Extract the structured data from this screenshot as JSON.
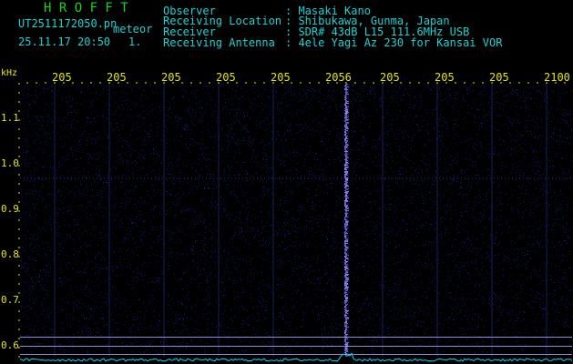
{
  "app": {
    "title": "H R O F F T",
    "filename": "UT2511172050.pn",
    "mode_label": "meteor",
    "datetime": "25.11.17 20:50",
    "index": "1."
  },
  "info": [
    {
      "label": "Observer",
      "value": ": Masaki Kano"
    },
    {
      "label": "Receiving Location",
      "value": ": Shibukawa, Gunma, Japan"
    },
    {
      "label": "Receiver",
      "value": ": SDR# 43dB L15 111.6MHz USB"
    },
    {
      "label": "Receiving Antenna",
      "value": ": 4ele Yagi Az 230 for Kansai VOR"
    }
  ],
  "axis": {
    "y_unit": "kHz",
    "x_ticks": [
      "205",
      "205",
      "205",
      "205",
      "205",
      "2056",
      "205",
      "205",
      "205",
      "2100"
    ],
    "y_ticks": [
      "1.1",
      "1.0",
      "0.9",
      "0.8",
      "0.7",
      "0.6"
    ]
  },
  "colors": {
    "background": "#000000",
    "header_green": "#19d219",
    "header_cyan": "#19d2d2",
    "tick_yellow": "#e6e600",
    "noise_blue": "#1a1acc",
    "signal": "#8888ff",
    "baseline": "#b0b0ff",
    "power_trace": "#00d8ff"
  }
}
